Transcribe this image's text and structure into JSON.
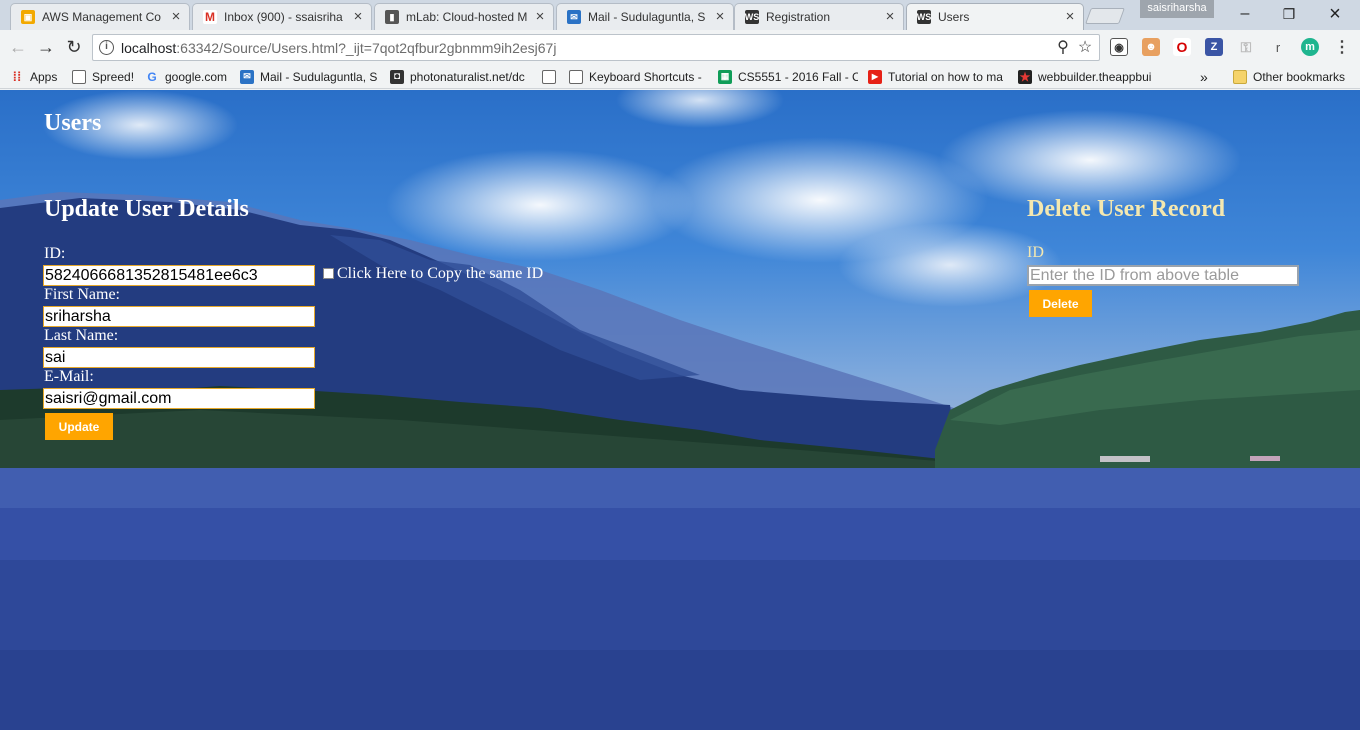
{
  "browser": {
    "tabs": [
      {
        "title": "AWS Management Co",
        "icon": "aws-icon",
        "color": "#f2a900",
        "active": false
      },
      {
        "title": "Inbox (900) - ssaisriha",
        "icon": "gmail-icon",
        "color": "#d93025",
        "active": false
      },
      {
        "title": "mLab: Cloud-hosted M",
        "icon": "mlab-icon",
        "color": "#555555",
        "active": false
      },
      {
        "title": "Mail - Sudulaguntla, S",
        "icon": "mail-icon",
        "color": "#2a72c5",
        "active": false
      },
      {
        "title": "Registration",
        "icon": "webstorm-icon",
        "color": "#333333",
        "active": false
      },
      {
        "title": "Users",
        "icon": "webstorm-icon",
        "color": "#333333",
        "active": true
      }
    ],
    "profile_name": "saisriharsha",
    "url_host": "localhost",
    "url_rest": ":63342/Source/Users.html?_ijt=7qot2qfbur2gbnmm9ih2esj67j",
    "bookmarks": [
      {
        "label": "Apps",
        "icon": "apps-grid-icon"
      },
      {
        "label": "Spreed!",
        "icon": "page-icon"
      },
      {
        "label": "google.com",
        "icon": "google-icon"
      },
      {
        "label": "Mail - Sudulaguntla, S",
        "icon": "mail-icon"
      },
      {
        "label": "photonaturalist.net/dc",
        "icon": "camera-icon"
      },
      {
        "label": "",
        "icon": "page-icon"
      },
      {
        "label": "Keyboard Shortcuts -",
        "icon": "page-icon"
      },
      {
        "label": "CS5551 - 2016 Fall - C",
        "icon": "sheets-icon"
      },
      {
        "label": "Tutorial on how to ma",
        "icon": "youtube-icon"
      },
      {
        "label": "webbuilder.theappbui",
        "icon": "star-icon"
      }
    ],
    "overflow_label": "»",
    "other_bookmarks": "Other bookmarks"
  },
  "page": {
    "title": "Users",
    "update": {
      "heading": "Update User Details",
      "id_label": "ID:",
      "id_value": "5824066681352815481ee6c3",
      "copy_label": "Click Here to Copy the same ID",
      "first_name_label": "First Name:",
      "first_name_value": "sriharsha",
      "last_name_label": "Last Name:",
      "last_name_value": "sai",
      "email_label": "E-Mail:",
      "email_value": "saisri@gmail.com",
      "button_label": "Update"
    },
    "delete": {
      "heading": "Delete User Record",
      "id_label": "ID",
      "placeholder": "Enter the ID from above table",
      "button_label": "Delete"
    }
  },
  "colors": {
    "button": "#ffa500",
    "delete_heading": "#f4e8b0"
  }
}
